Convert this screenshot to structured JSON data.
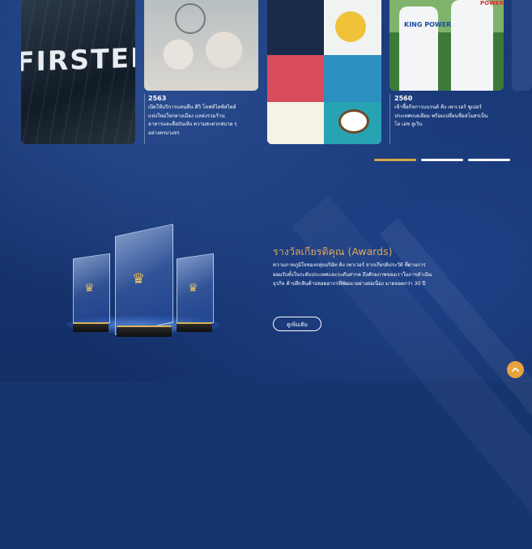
{
  "carousel": {
    "cards": [
      {
        "logo_text": "FIRSTER"
      },
      {
        "year": "2563",
        "caption": "เปิดให้บริการแคนทีน ศิวิ โลฟท์ไลฟ์สไตล์แห่งใหม่ใจกลางเมือง แหล่งรวมร้านอาหารและสื่อบันเทิง ความสะดวกสบาย ๆ อย่างครบวงจร"
      },
      {},
      {
        "year": "2560",
        "caption": "เข้าซื้อกิจการแบรนด์ คิง เพาเวอร์ ซูเปอร์ ประเทศเบลเยียม พร้อมเปลี่ยนชื่อสโมสรเป็น โอ เอช ลูเวิน",
        "shirt_text": "KING POWER",
        "shirt_text_2": "POWER"
      }
    ],
    "indicators": [
      {
        "active": true
      },
      {
        "active": false
      },
      {
        "active": false
      }
    ]
  },
  "awards": {
    "title": "รางวัลเกียรติคุณ (Awards)",
    "body": "ความภาคภูมิใจของกลุ่มบริษัท คิง เพาเวอร์ จากเกียรติประวัติ ที่ผ่านการยอมรับทั้งในระดับประเทศและระดับสากล ถึงศักยภาพของเราในการดำเนินธุรกิจ ค้าปลีกสินค้าปลอดอากรที่พัฒนาอย่างต่อเนื่อง มาตลอดกว่า 30 ปี",
    "button_label": "ดูเพิ่มเติม"
  },
  "colors": {
    "accent": "#e0a85b",
    "background": "#16356f",
    "scroll_top": "#e7a43b"
  },
  "icons": {
    "scroll_top": "chevron-up-icon",
    "award_crown": "crown-icon"
  }
}
